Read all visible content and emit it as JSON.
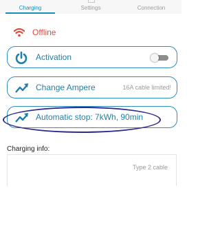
{
  "tabs": [
    {
      "label": "Charging",
      "active": true
    },
    {
      "label": "Settings",
      "active": false
    },
    {
      "label": "Connection",
      "active": false
    }
  ],
  "status": {
    "text": "Offline",
    "icon": "wifi-icon",
    "color": "#e14b3e"
  },
  "cards": {
    "activation": {
      "title": "Activation",
      "icon": "power-icon",
      "toggle_on": false
    },
    "change_ampere": {
      "title": "Change Ampere",
      "meta": "16A cable limited!",
      "icon": "trend-up-icon"
    },
    "auto_stop": {
      "title": "Automatic stop: 7kWh, 90min",
      "icon": "trend-up-icon"
    }
  },
  "charging_info": {
    "label": "Charging info:",
    "partial_value": "Type 2 cable"
  },
  "colors": {
    "accent": "#1e8ab6",
    "offline": "#e14b3e",
    "annotation": "#2e2a8b"
  }
}
